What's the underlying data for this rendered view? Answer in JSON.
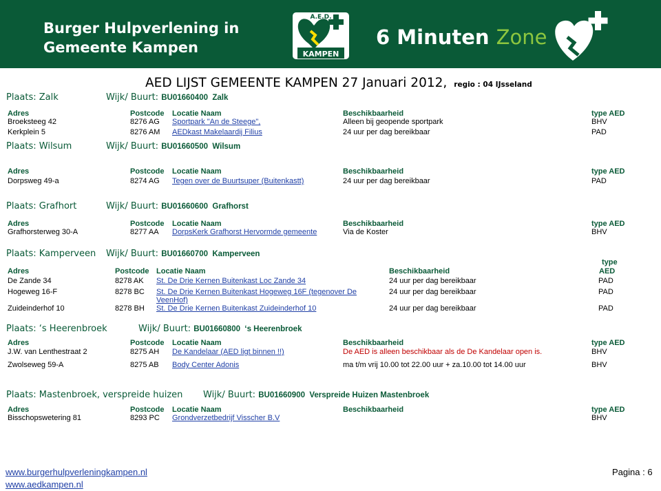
{
  "banner": {
    "title_line1": "Burger Hulpverlening in",
    "title_line2": "Gemeente Kampen",
    "badge_top": "A.E.D.",
    "badge_bottom": "KAMPEN",
    "zone_part1": "6 Minuten",
    "zone_part2": "Zone",
    "colors": {
      "background": "#0a5a37",
      "accent": "#8dc63f"
    }
  },
  "document": {
    "title": "AED LIJST  GEMEENTE KAMPEN  27 Januari 2012,",
    "region": "regio : 04 IJsseland"
  },
  "column_labels": {
    "adres": "Adres",
    "postcode": "Postcode",
    "locatie": "Locatie Naam",
    "beschikbaarheid": "Beschikbaarheid",
    "type_aed": "type AED",
    "type": "type",
    "aed": "AED"
  },
  "sections": [
    {
      "plaats": "Plaats:  Zalk",
      "wijk_label": "Wijk/ Buurt:",
      "wijk_code": "BU01660400",
      "wijk_name": "Zalk",
      "rows": [
        {
          "adres": "Broeksteeg 42",
          "postcode": "8276 AG",
          "locatie": "Sportpark \"An de Steege\",",
          "beschikbaarheid": "Alleen bij geopende sportpark",
          "type": "BHV"
        },
        {
          "adres": "Kerkplein 5",
          "postcode": "8276 AM",
          "locatie": "AEDkast Makelaardij Filius",
          "beschikbaarheid": "24 uur per dag bereikbaar",
          "type": "PAD"
        }
      ]
    },
    {
      "plaats": "Plaats:  Wilsum",
      "wijk_label": "Wijk/ Buurt:",
      "wijk_code": "BU01660500",
      "wijk_name": "Wilsum",
      "rows": [
        {
          "adres": "Dorpsweg 49-a",
          "postcode": "8274 AG",
          "locatie": "Tegen over de Buurtsuper (Buitenkastt)",
          "beschikbaarheid": "24 uur per dag bereikbaar",
          "type": "PAD"
        }
      ]
    },
    {
      "plaats": "Plaats:  Grafhort",
      "wijk_label": "Wijk/ Buurt:",
      "wijk_code": "BU01660600",
      "wijk_name": "Grafhorst",
      "rows": [
        {
          "adres": "Grafhorsterweg 30-A",
          "postcode": "8277 AA",
          "locatie": "DorpsKerk Grafhorst Hervormde gemeente",
          "beschikbaarheid": "Via de Koster",
          "type": "BHV"
        }
      ]
    },
    {
      "plaats": "Plaats:  Kamperveen",
      "wijk_label": "Wijk/ Buurt:",
      "wijk_code": "BU01660700",
      "wijk_name": "Kamperveen",
      "rows": [
        {
          "adres": "De Zande 34",
          "postcode": "8278 AK",
          "locatie": "St. De Drie Kernen Buitenkast  Loc Zande 34",
          "beschikbaarheid": "24 uur per dag bereikbaar",
          "type": "PAD"
        },
        {
          "adres": "Hogeweg 16-F",
          "postcode": "8278 BC",
          "locatie": "St. De Drie Kernen Buitenkast Hogeweg 16F (tegenover  De",
          "locatie_line2": "VeenHof)",
          "beschikbaarheid": "24 uur per dag bereikbaar",
          "type": "PAD"
        },
        {
          "adres": "Zuideinderhof 10",
          "postcode": "8278 BH",
          "locatie": "St. De Drie Kernen Buitenkast  Zuideinderhof 10",
          "beschikbaarheid": "24 uur per dag bereikbaar",
          "type": "PAD"
        }
      ]
    },
    {
      "plaats": "Plaats:  ‘s Heerenbroek",
      "wijk_label": "Wijk/ Buurt:",
      "wijk_code": "BU01660800",
      "wijk_name": "‘s Heerenbroek",
      "rows": [
        {
          "adres": "J.W. van Lenthestraat 2",
          "postcode": "8275 AH",
          "locatie": "De Kandelaar  (AED ligt binnen !!)",
          "beschikbaarheid": "De AED is alleen beschikbaar als de De Kandelaar open is.",
          "type": "BHV"
        },
        {
          "adres": "Zwolseweg 59-A",
          "postcode": "8275 AB",
          "locatie": "Body Center Adonis",
          "beschikbaarheid": "ma t/m vrij 10.00 tot 22.00 uur + za.10.00 tot 14.00 uur",
          "type": "BHV"
        }
      ]
    },
    {
      "plaats": "Plaats:  Mastenbroek, verspreide huizen",
      "wijk_label": "Wijk/ Buurt:",
      "wijk_code": "BU01660900",
      "wijk_name": "Verspreide Huizen Mastenbroek",
      "rows": [
        {
          "adres": "Bisschopswetering 81",
          "postcode": "8293 PC",
          "locatie": "Grondverzetbedrijf Visscher B.V",
          "beschikbaarheid": "",
          "type": "BHV"
        }
      ]
    }
  ],
  "footer": {
    "link1": "www.burgerhulpverleningkampen.nl",
    "link2": "www.aedkampen.nl",
    "page": "Pagina : 6"
  }
}
